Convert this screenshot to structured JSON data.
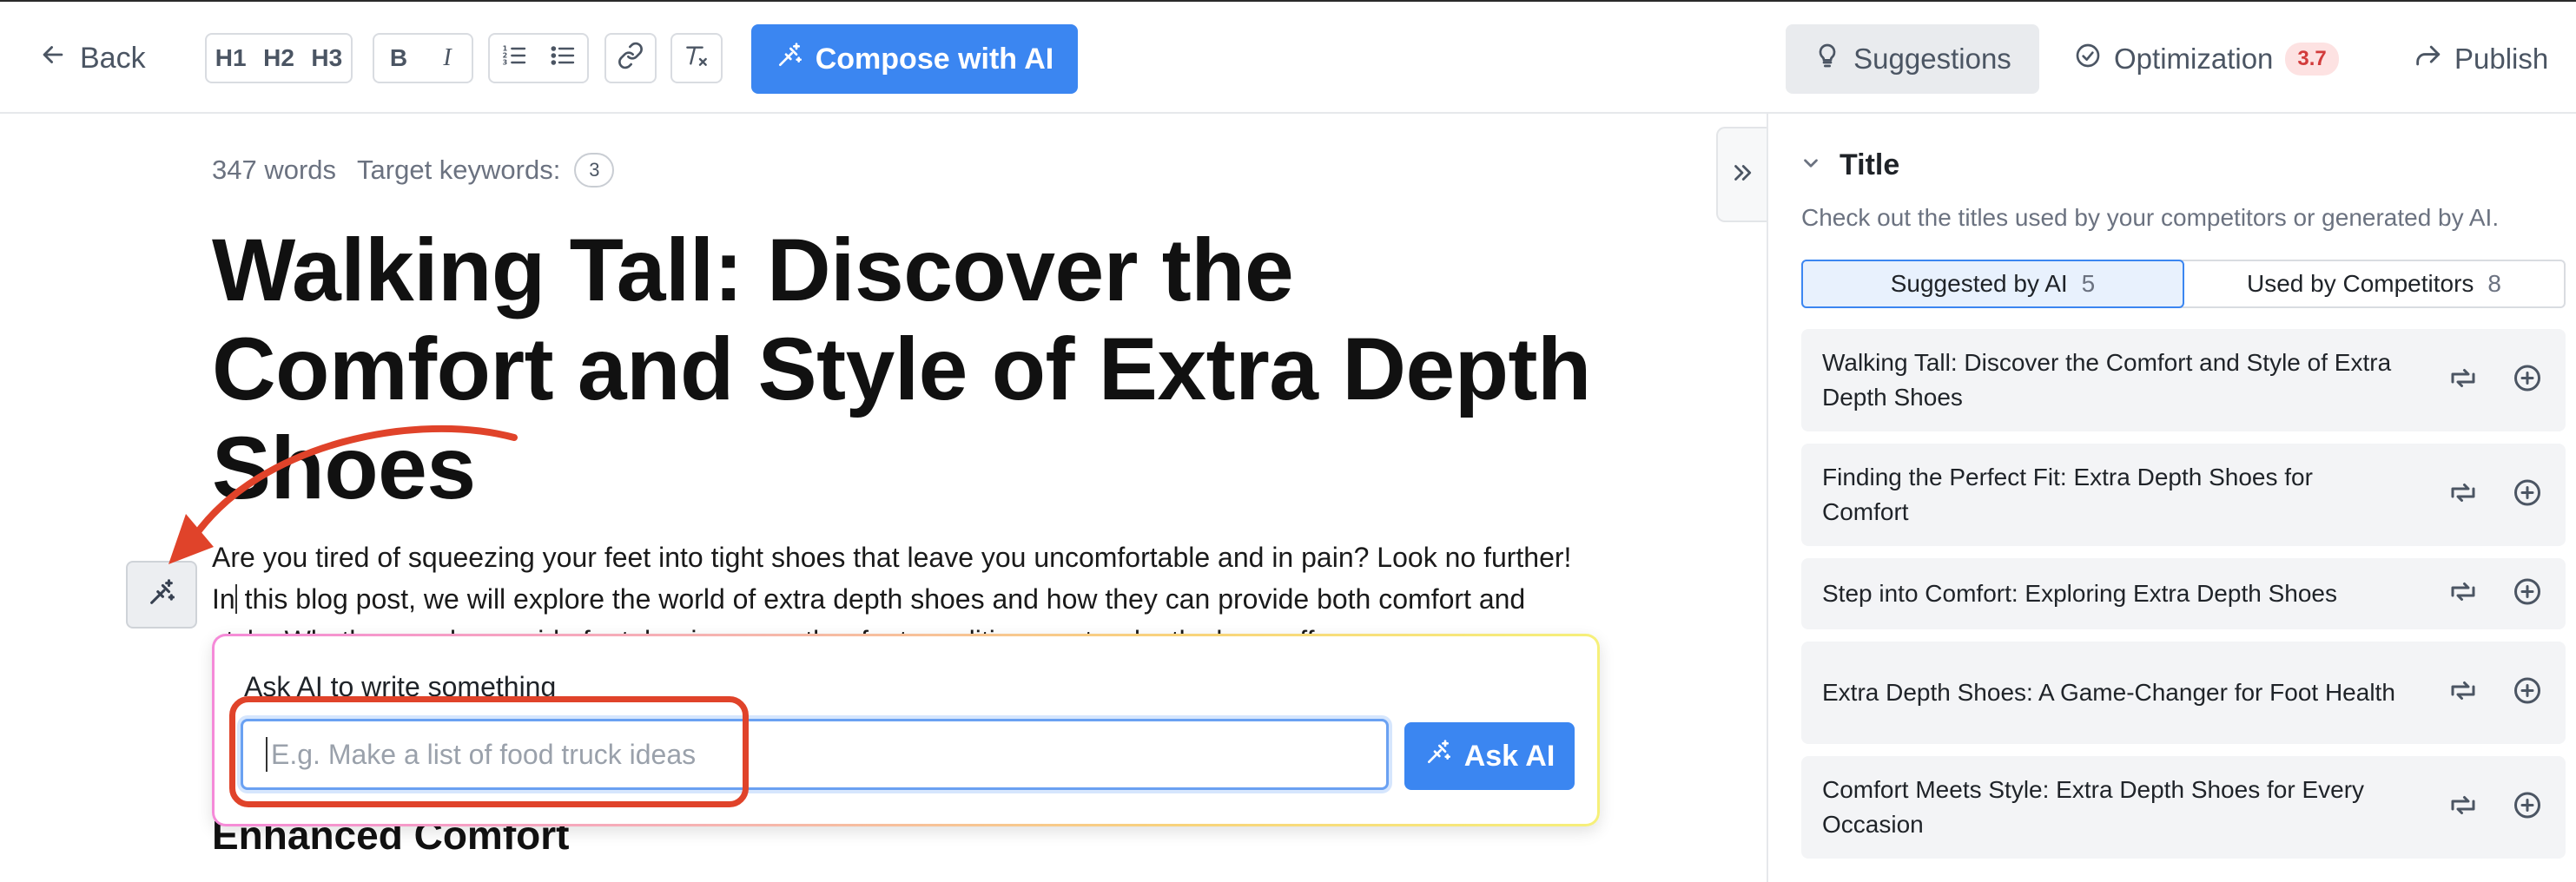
{
  "toolbar": {
    "back_label": "Back",
    "formatting": {
      "h1": "H1",
      "h2": "H2",
      "h3": "H3",
      "bold": "B",
      "italic": "I"
    },
    "compose_label": "Compose with AI",
    "suggestions_label": "Suggestions",
    "optimization_label": "Optimization",
    "optimization_score": "3.7",
    "publish_label": "Publish"
  },
  "editor": {
    "word_count": "347 words",
    "target_keywords_label": "Target keywords:",
    "target_keywords_count": "3",
    "title": "Walking Tall: Discover the Comfort and Style of Extra Depth Shoes",
    "paragraph_before_cursor": "Are you tired of squeezing your feet into tight shoes that leave you uncomfortable and in pain? Look no further! In",
    "paragraph_after_cursor": " this blog post, we will explore the world of extra depth shoes and how they can provide both comfort and style. Whether you have wide feet, bunions, or other foot conditions, extra depth shoes offer",
    "heading_2": "Enhanced Comfort"
  },
  "ask_ai": {
    "label": "Ask AI to write something",
    "placeholder": "E.g. Make a list of food truck ideas",
    "button_label": "Ask AI"
  },
  "sidebar": {
    "section_title": "Title",
    "description": "Check out the titles used by your competitors or generated by AI.",
    "tabs": [
      {
        "label": "Suggested by AI",
        "count": "5",
        "active": true
      },
      {
        "label": "Used by Competitors",
        "count": "8",
        "active": false
      }
    ],
    "suggestions": [
      "Walking Tall: Discover the Comfort and Style of Extra Depth Shoes",
      "Finding the Perfect Fit: Extra Depth Shoes for Comfort",
      "Step into Comfort: Exploring Extra Depth Shoes",
      "Extra Depth Shoes: A Game-Changer for Foot Health",
      "Comfort Meets Style: Extra Depth Shoes for Every Occasion"
    ]
  },
  "colors": {
    "primary": "#3b86f1",
    "annotation_red": "#e0432a",
    "score_badge_bg": "#fde2e2",
    "score_badge_text": "#d23b3b"
  }
}
